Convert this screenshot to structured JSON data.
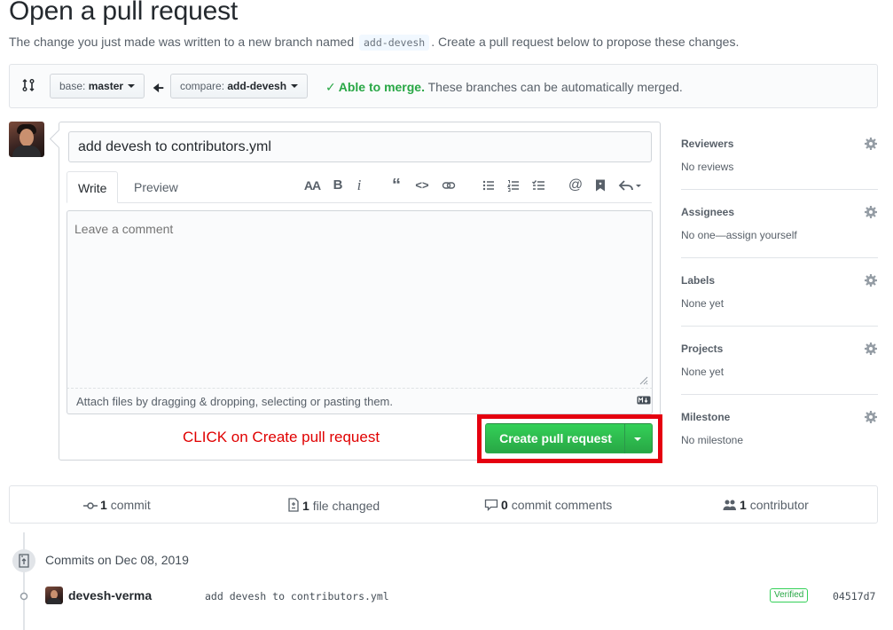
{
  "page": {
    "title": "Open a pull request",
    "subtitle_before": "The change you just made was written to a new branch named",
    "branch_name": "add-devesh",
    "subtitle_after": ". Create a pull request below to propose these changes."
  },
  "range": {
    "base_label": "base:",
    "base_value": "master",
    "compare_label": "compare:",
    "compare_value": "add-devesh",
    "merge_ok": "Able to merge.",
    "merge_text": "These branches can be automatically merged."
  },
  "form": {
    "title_value": "add devesh to contributors.yml",
    "tab_write": "Write",
    "tab_preview": "Preview",
    "comment_placeholder": "Leave a comment",
    "attach_text": "Attach files by dragging & dropping, selecting or pasting them.",
    "instruction": "CLICK on Create pull request",
    "submit_label": "Create pull request"
  },
  "sidebar": [
    {
      "heading": "Reviewers",
      "value": "No reviews"
    },
    {
      "heading": "Assignees",
      "value": "No one—assign yourself"
    },
    {
      "heading": "Labels",
      "value": "None yet"
    },
    {
      "heading": "Projects",
      "value": "None yet"
    },
    {
      "heading": "Milestone",
      "value": "No milestone"
    }
  ],
  "summary": {
    "commits_count": "1",
    "commits_label": "commit",
    "files_count": "1",
    "files_label": "file changed",
    "comments_count": "0",
    "comments_label": "commit comments",
    "contributors_count": "1",
    "contributors_label": "contributor"
  },
  "commits": {
    "date_heading": "Commits on Dec 08, 2019",
    "items": [
      {
        "author": "devesh-verma",
        "message": "add devesh to contributors.yml",
        "badge": "Verified",
        "sha": "04517d7"
      }
    ]
  },
  "colors": {
    "merge_ok": "#28a745",
    "button": "#2ea44f",
    "highlight": "#e5000f",
    "instruction": "#e00000"
  }
}
